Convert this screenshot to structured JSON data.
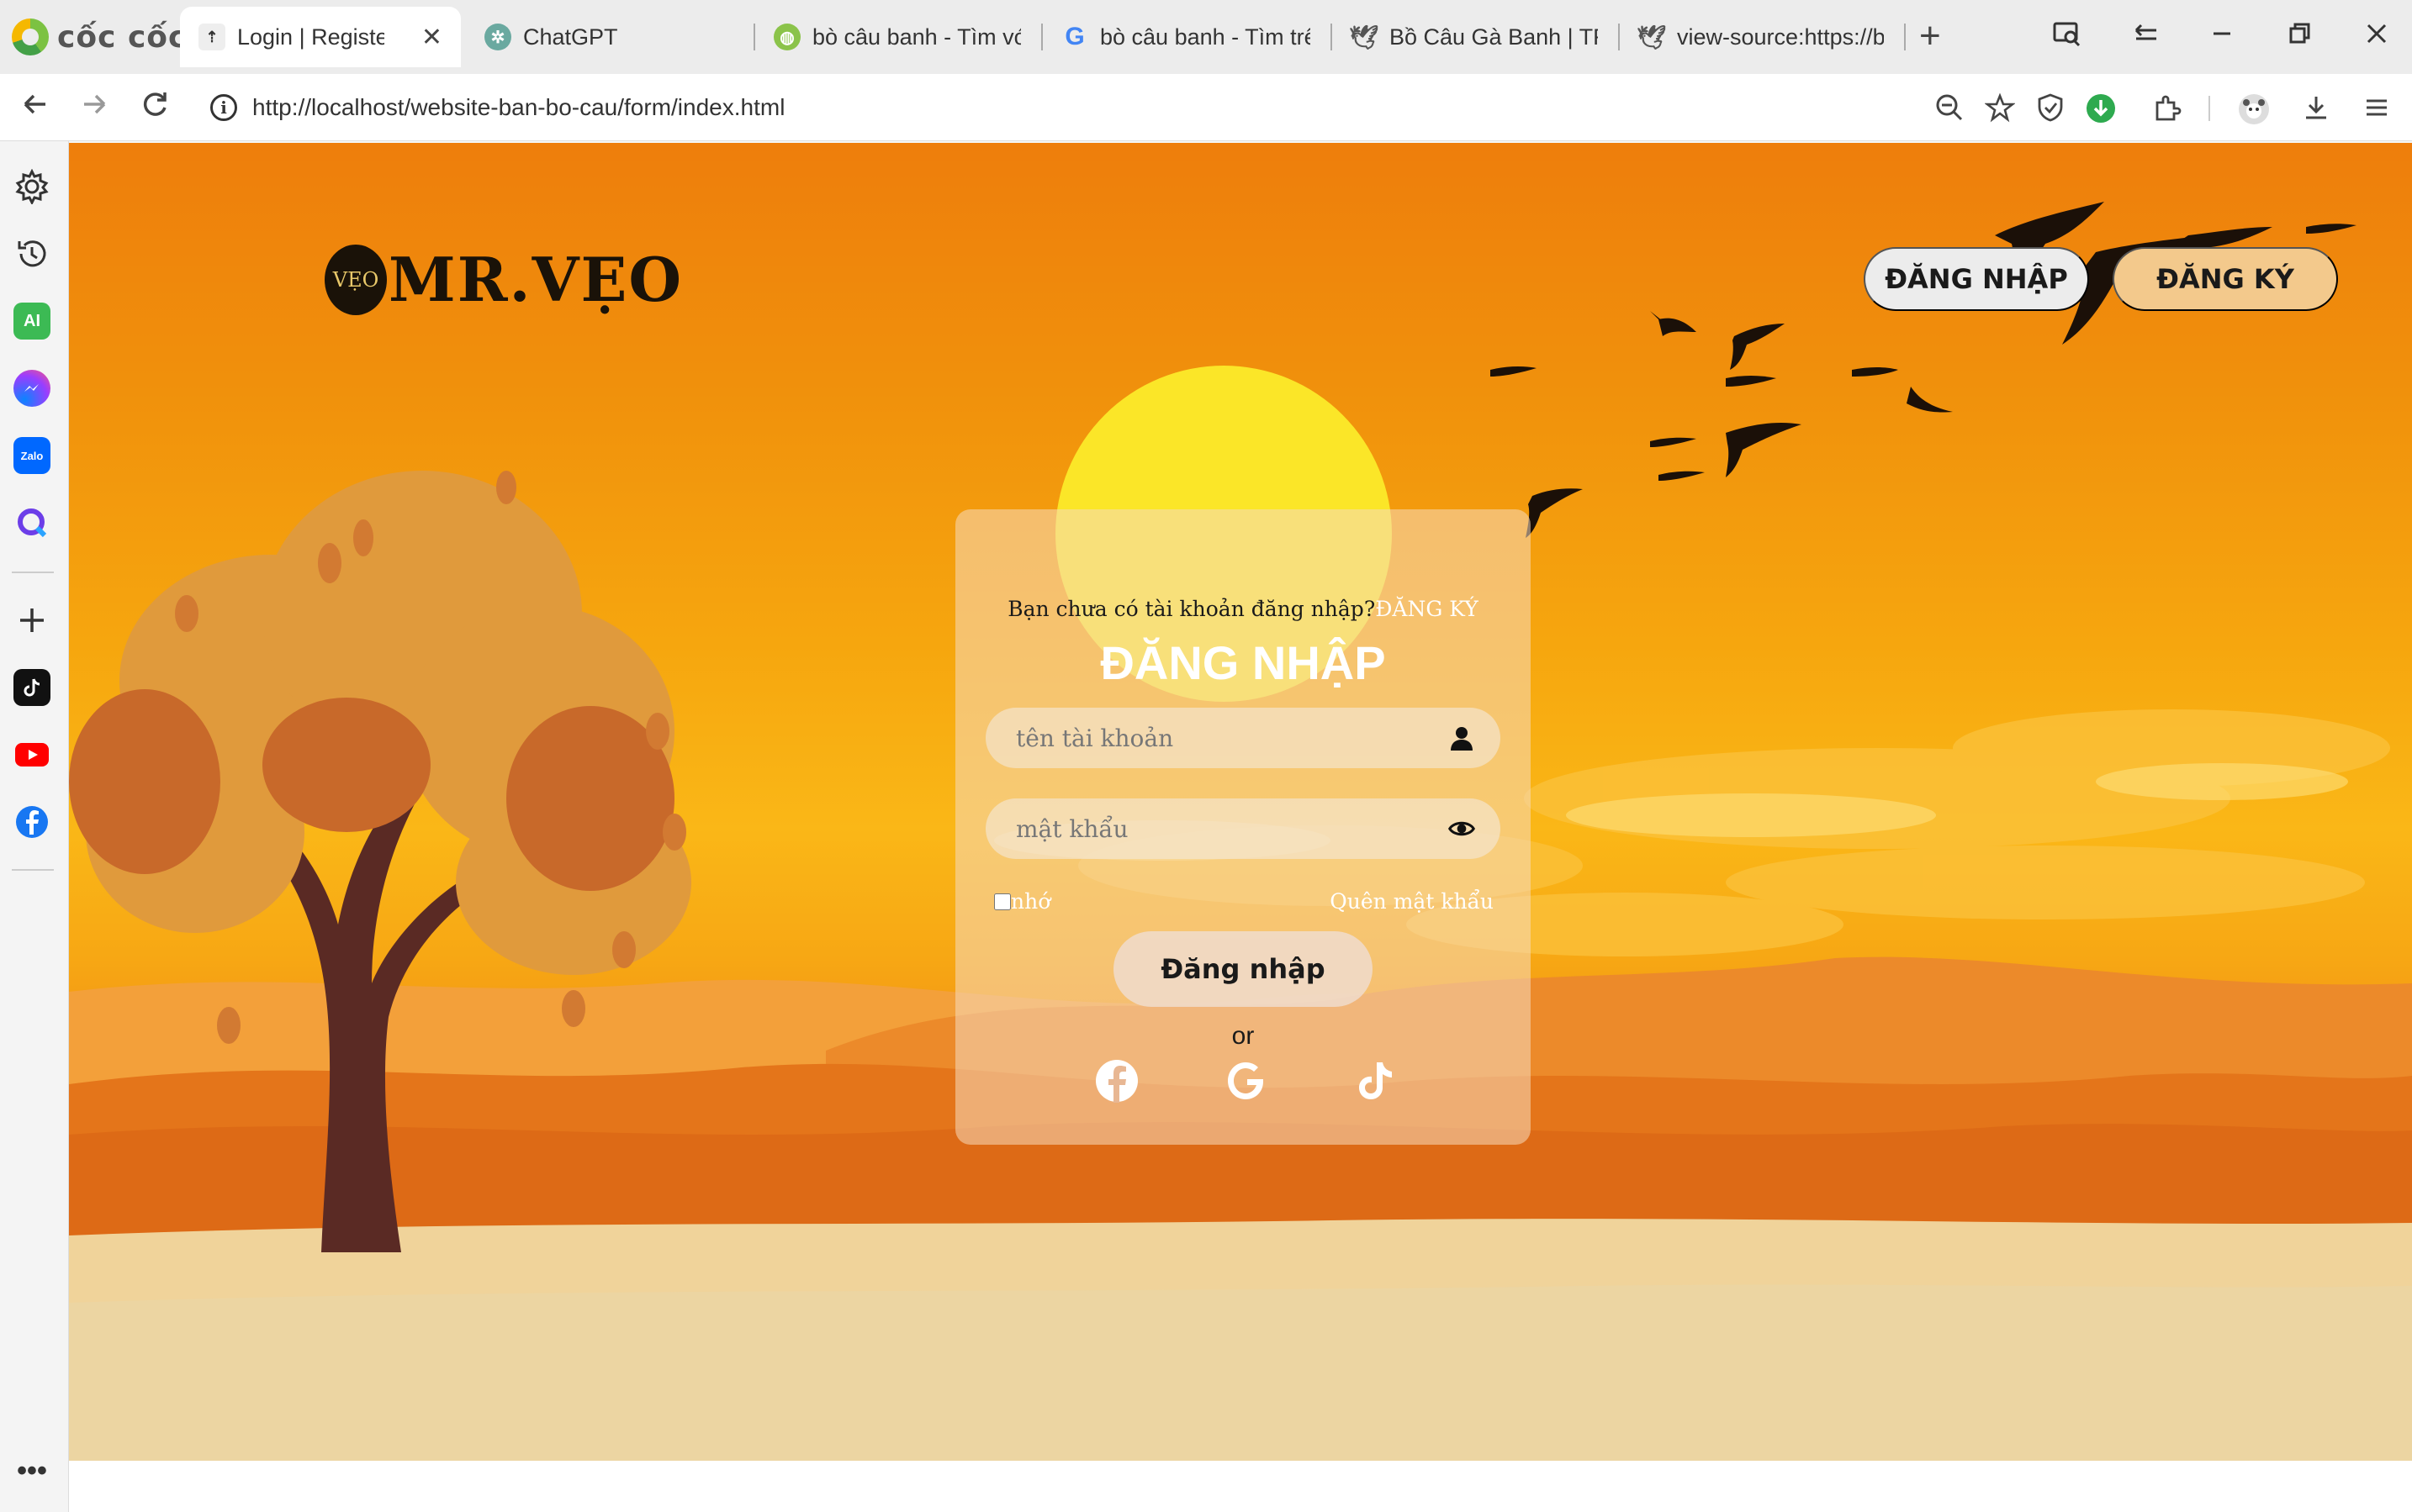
{
  "browser": {
    "brand": "cốc cốc",
    "tabs": [
      {
        "label": "Login | Register",
        "active": true
      },
      {
        "label": "ChatGPT"
      },
      {
        "label": "bò câu banh - Tìm với"
      },
      {
        "label": "bò câu banh - Tìm trên"
      },
      {
        "label": "Bồ Câu Gà Banh | TRẠ"
      },
      {
        "label": "view-source:https://bo"
      }
    ],
    "close_tab": "✕",
    "new_tab": "+",
    "url": "http://localhost/website-ban-bo-cau/form/index.html",
    "colors": {
      "download_badge": "#2eaa4f",
      "accent": "#e8590c"
    }
  },
  "sidebar": {
    "items": [
      {
        "icon": "settings-icon"
      },
      {
        "icon": "history-icon"
      },
      {
        "icon": "ai-icon",
        "label": "AI"
      },
      {
        "icon": "messenger-icon"
      },
      {
        "icon": "zalo-icon",
        "label": "Zalo"
      },
      {
        "icon": "search-q-icon"
      },
      {
        "icon": "add-icon"
      },
      {
        "icon": "tiktok-icon"
      },
      {
        "icon": "youtube-icon"
      },
      {
        "icon": "facebook-icon"
      },
      {
        "icon": "more-icon"
      }
    ]
  },
  "site": {
    "logo_badge": "VẸO",
    "logo_text": "MR.VẸO",
    "header_login": "ĐĂNG NHẬP",
    "header_register": "ĐĂNG KÝ"
  },
  "login_form": {
    "prompt": "Bạn chưa có tài khoản đăng nhập?",
    "register_link": "ĐĂNG KÝ",
    "title": "ĐĂNG NHẬP",
    "username_placeholder": "tên tài khoản",
    "password_placeholder": "mật khẩu",
    "remember_label": "nhớ",
    "forgot_label": "Quên mật khẩu",
    "submit_label": "Đăng nhập",
    "or_label": "or",
    "social": [
      "facebook-icon",
      "google-icon",
      "tiktok-icon"
    ]
  }
}
